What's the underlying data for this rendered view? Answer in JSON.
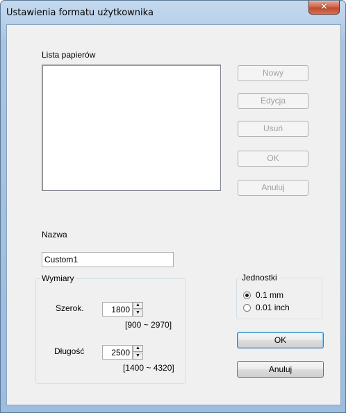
{
  "window": {
    "title": "Ustawienia formatu użytkownika",
    "close_icon": "×"
  },
  "paper_list": {
    "label": "Lista papierów",
    "items": []
  },
  "side_buttons": {
    "new": "Nowy",
    "edit": "Edycja",
    "delete": "Usuń",
    "ok": "OK",
    "cancel": "Anuluj"
  },
  "name": {
    "label": "Nazwa",
    "value": "Custom1"
  },
  "dimensions": {
    "title": "Wymiary",
    "width_label": "Szerok.",
    "width_value": "1800",
    "width_range": "[900 ~ 2970]",
    "length_label": "Długość",
    "length_value": "2500",
    "length_range": "[1400 ~ 4320]"
  },
  "units": {
    "title": "Jednostki",
    "options": [
      "0.1 mm",
      "0.01 inch"
    ],
    "selected": "0.1 mm"
  },
  "dialog_buttons": {
    "ok": "OK",
    "cancel": "Anuluj"
  },
  "colors": {
    "frame": "#b9d1ea",
    "client": "#f0f0f0",
    "close": "#c24b2c",
    "default_border": "#3c7fb1"
  }
}
